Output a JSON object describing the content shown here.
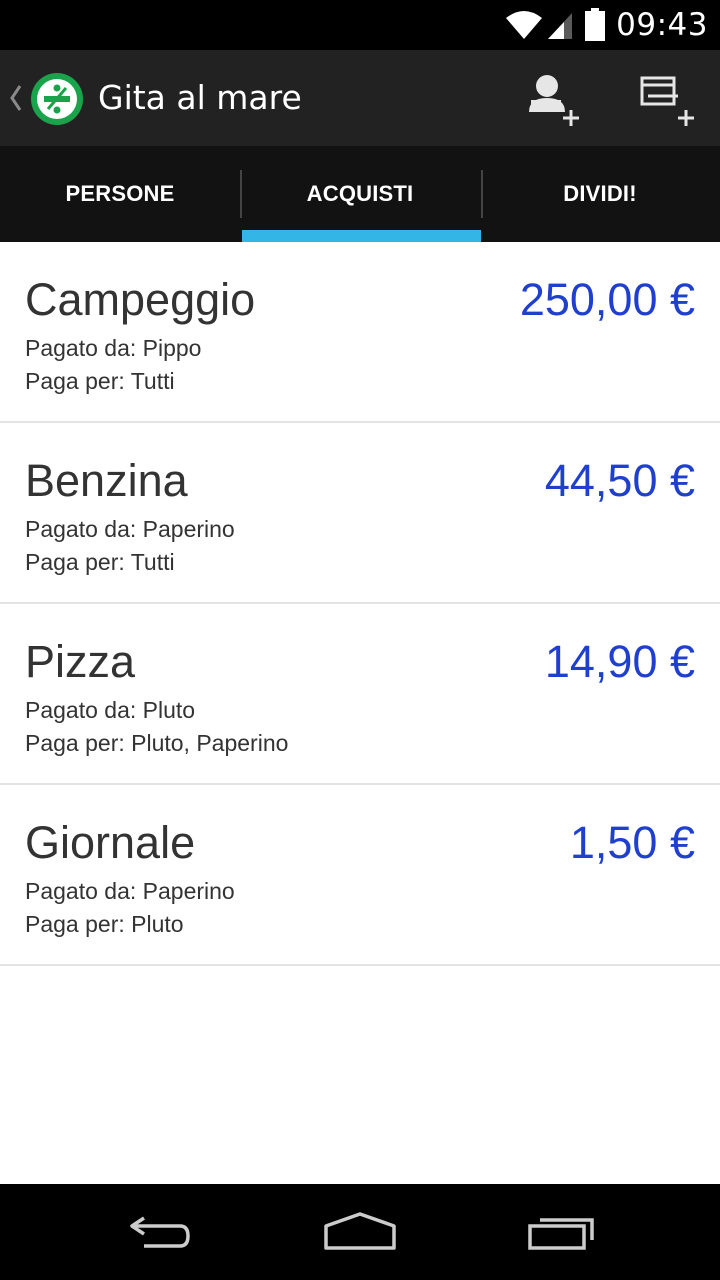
{
  "status_bar": {
    "time": "09:43",
    "icons": [
      "wifi-icon",
      "signal-icon",
      "battery-icon"
    ]
  },
  "action_bar": {
    "title": "Gita al mare",
    "icons": [
      "back-chevron-icon",
      "app-logo-icon",
      "add-person-icon",
      "add-purchase-icon"
    ]
  },
  "tabs": [
    {
      "label": "PERSONE",
      "selected": false
    },
    {
      "label": "ACQUISTI",
      "selected": true
    },
    {
      "label": "DIVIDI!",
      "selected": false
    }
  ],
  "purchases": [
    {
      "name": "Campeggio",
      "amount": "250,00 €",
      "paid_by": "Pagato da: Pippo",
      "pays_for": "Paga per: Tutti"
    },
    {
      "name": "Benzina",
      "amount": "44,50 €",
      "paid_by": "Pagato da: Paperino",
      "pays_for": "Paga per: Tutti"
    },
    {
      "name": "Pizza",
      "amount": "14,90 €",
      "paid_by": "Pagato da: Pluto",
      "pays_for": "Paga per: Pluto, Paperino"
    },
    {
      "name": "Giornale",
      "amount": "1,50 €",
      "paid_by": "Pagato da: Paperino",
      "pays_for": "Paga per: Pluto"
    }
  ],
  "nav_bar": {
    "icons": [
      "back-icon",
      "home-icon",
      "recents-icon"
    ]
  },
  "colors": {
    "accent": "#33b5e5",
    "amount": "#1f3fcf",
    "logo_green": "#1aa34a",
    "action_bar": "#222222",
    "tab_bar": "#121212"
  }
}
